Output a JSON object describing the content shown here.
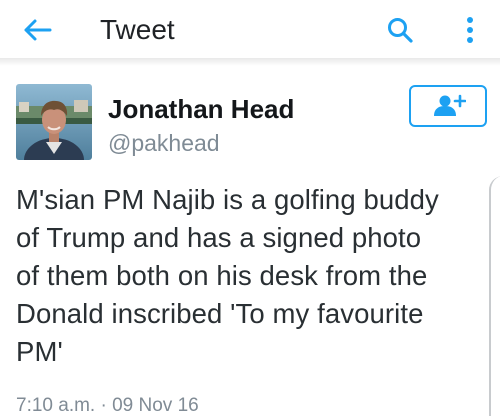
{
  "header": {
    "title": "Tweet",
    "back_icon": "arrow-left-icon",
    "search_icon": "search-icon",
    "more_icon": "more-vertical-icon"
  },
  "tweet": {
    "author_name": "Jonathan Head",
    "author_handle": "@pakhead",
    "follow_icon": "follow-user-icon",
    "text_lines": [
      "M'sian PM Najib is a golfing buddy",
      "of Trump and has a signed photo",
      "of them both on his desk from the",
      "Donald inscribed 'To my favourite",
      "PM'"
    ],
    "timestamp": "7:10 a.m. · 09 Nov 16"
  },
  "colors": {
    "accent": "#1da1f2",
    "name_text": "#14171a",
    "body_text": "#292f33",
    "secondary_text": "#7f8b95"
  }
}
